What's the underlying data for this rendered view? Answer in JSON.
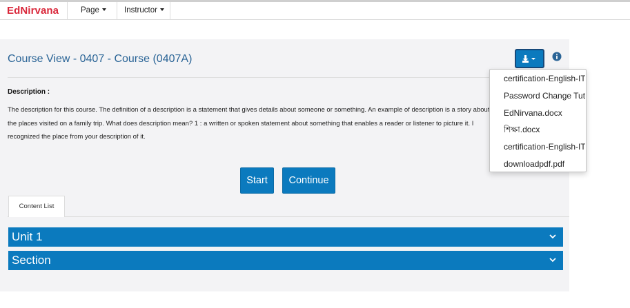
{
  "nav": {
    "brand": "EdNirvana",
    "items": [
      {
        "label": "Page"
      },
      {
        "label": "Instructor"
      }
    ]
  },
  "course": {
    "title": "Course View - 0407 - Course (0407A)",
    "description_label": "Description :",
    "description_text": "The description for this course. The definition of a description is a statement that gives details about someone or something. An example of description is a story about the places visited on a family trip. What does description mean? 1 : a written or spoken statement about something that enables a reader or listener to picture it. I recognized the place from your description of it."
  },
  "actions": {
    "start_label": "Start",
    "continue_label": "Continue"
  },
  "tabs": [
    {
      "label": "Content List",
      "active": true
    }
  ],
  "accordion": [
    {
      "label": "Unit 1"
    },
    {
      "label": "Section"
    }
  ],
  "download_menu": {
    "items": [
      {
        "label": "certification-English-IT..."
      },
      {
        "label": "Password Change Tutorial..."
      },
      {
        "label": "EdNirvana.docx"
      },
      {
        "label": "শিক্ষা.docx"
      },
      {
        "label": "certification-English-IT..."
      },
      {
        "label": "downloadpdf.pdf"
      }
    ]
  },
  "colors": {
    "brand": "#d9273a",
    "primary": "#0b7abe",
    "title": "#2a6496",
    "panel_bg": "#f3f3f5"
  },
  "icons": {
    "download": "download-icon",
    "info": "info-icon",
    "chevron": "chevron-down-icon"
  }
}
